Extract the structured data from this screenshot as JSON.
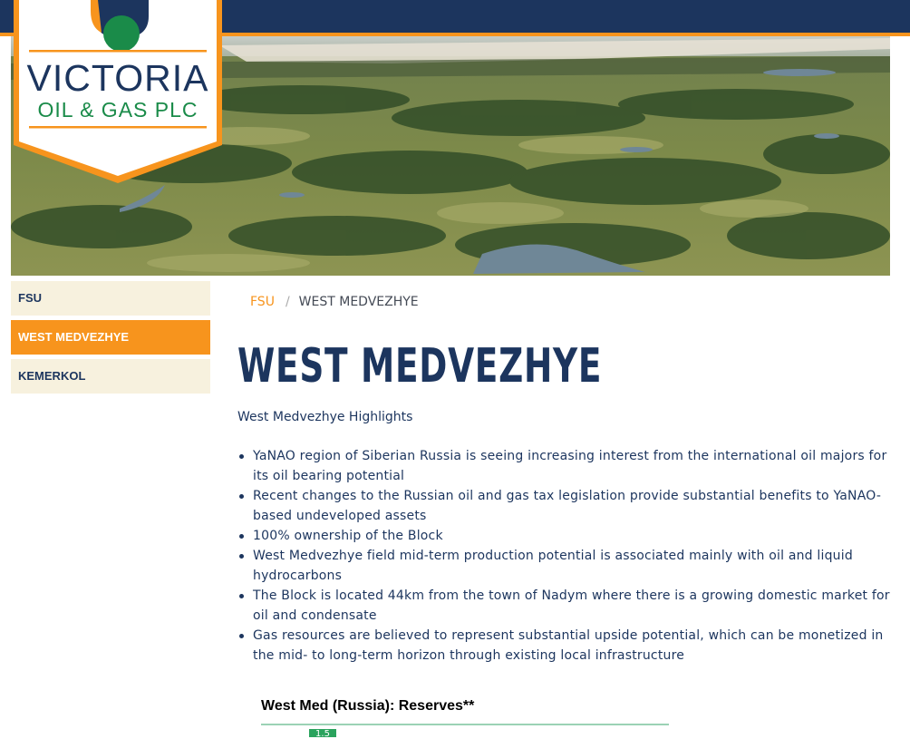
{
  "brand": {
    "name": "VICTORIA",
    "subtitle": "OIL & GAS PLC"
  },
  "nav": {
    "items": [
      {
        "label": "FSU"
      },
      {
        "label": "WEST MEDVEZHYE"
      },
      {
        "label": "KEMERKOL"
      }
    ]
  },
  "breadcrumb": {
    "parent": "FSU",
    "separator": "/",
    "current": "WEST MEDVEZHYE"
  },
  "page": {
    "title": "WEST MEDVEZHYE",
    "subtitle": "West Medvezhye Highlights",
    "highlights": [
      "YaNAO region of Siberian Russia is seeing increasing interest from the international oil majors for its oil bearing potential",
      "Recent changes to the Russian oil and gas tax legislation provide substantial benefits to YaNAO-based undeveloped assets",
      "100% ownership of the Block",
      "West Medvezhye field mid-term production potential is associated mainly with oil and liquid hydrocarbons",
      "The Block is located 44km from the town of Nadym where there is a growing domestic market for oil and condensate",
      "Gas resources are believed to represent substantial upside potential, which can be monetized in the mid- to long-term horizon through existing local infrastructure"
    ]
  },
  "reserves": {
    "title": "West Med (Russia): Reserves**",
    "first_value": "1.5"
  },
  "colors": {
    "navy": "#1c355e",
    "orange": "#f7941d",
    "green": "#1a8b49",
    "nav_bg": "#f7f1de"
  }
}
